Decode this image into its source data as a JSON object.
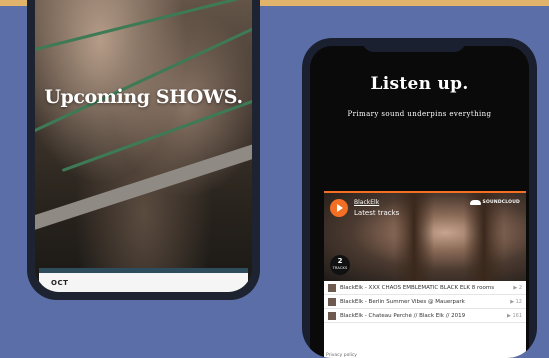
{
  "shows": {
    "title": "Upcoming SHOWS.",
    "card_month": "OCT"
  },
  "listen": {
    "title": "Listen up.",
    "subtitle": "Primary sound underpins everything"
  },
  "soundcloud": {
    "artist": "BlackElk",
    "heading": "Latest tracks",
    "brand": "SOUNDCLOUD",
    "track_count": "2",
    "track_count_label": "TRACKS",
    "tracks": [
      {
        "title": "BlackElk - XXX CHAOS EMBLEMATIC BLACK ELK 8 rooms",
        "plays": "2"
      },
      {
        "title": "BlackElk - Berlin Summer Vibes @ Mauerpark",
        "plays": "12"
      },
      {
        "title": "BlackElk - Chateau Perché // Black Elk // 2019",
        "plays": "161"
      }
    ],
    "privacy": "Privacy policy"
  },
  "colors": {
    "background": "#5b6ea8",
    "accent_border": "#e1b36b",
    "soundcloud_orange": "#f26f23"
  }
}
